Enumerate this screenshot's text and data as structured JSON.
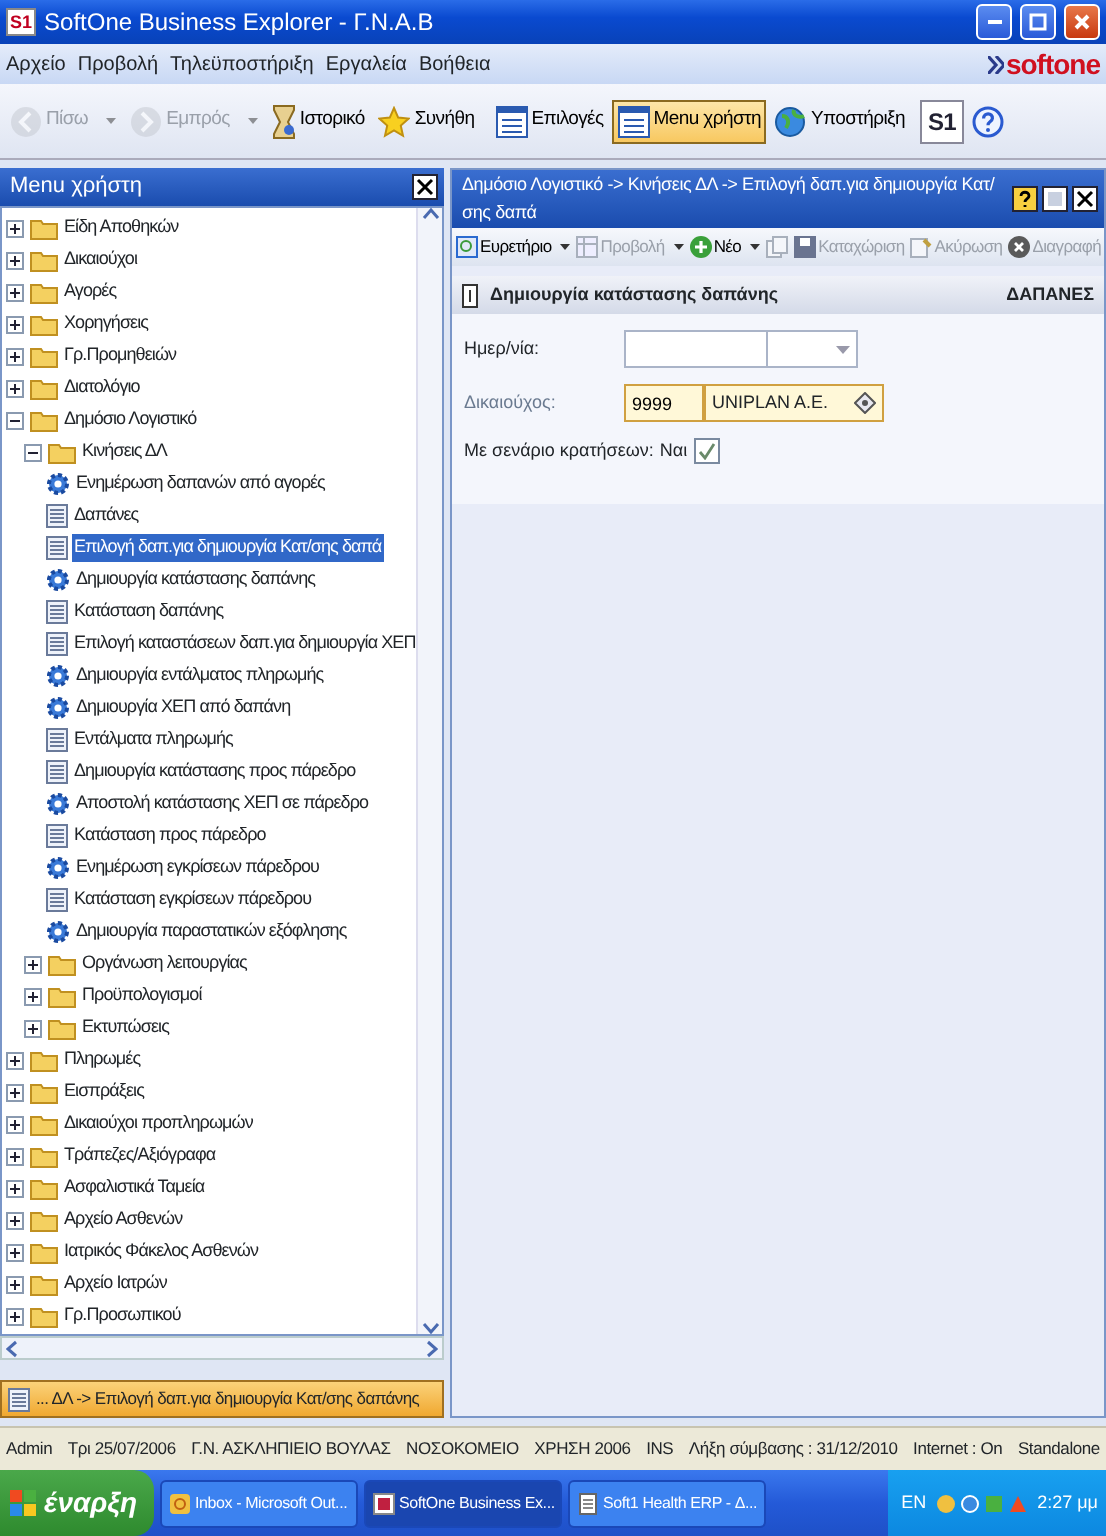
{
  "window": {
    "icon": "S1",
    "title": "SoftOne Business Explorer - Γ.Ν.Α.Β"
  },
  "menu": [
    "Αρχείο",
    "Προβολή",
    "Τηλεϋποστήριξη",
    "Εργαλεία",
    "Βοήθεια"
  ],
  "logo": "softone",
  "toolbar": [
    {
      "label": "Πίσω",
      "kind": "back",
      "disabled": true,
      "dropdown": true,
      "selected": false
    },
    {
      "label": "Εμπρός",
      "kind": "forward",
      "disabled": true,
      "dropdown": true,
      "selected": false
    },
    {
      "label": "Ιστορικό",
      "kind": "history",
      "disabled": false,
      "dropdown": false,
      "selected": false
    },
    {
      "label": "Συνήθη",
      "kind": "star",
      "disabled": false,
      "dropdown": false,
      "selected": false
    },
    {
      "label": "Επιλογές",
      "kind": "list",
      "disabled": false,
      "dropdown": false,
      "selected": false
    },
    {
      "label": "Menu χρήστη",
      "kind": "list",
      "disabled": false,
      "dropdown": false,
      "selected": true
    },
    {
      "label": "Υποστήριξη",
      "kind": "globe",
      "disabled": false,
      "dropdown": false,
      "selected": false
    },
    {
      "label": "S1",
      "kind": "brand",
      "disabled": false,
      "dropdown": false,
      "selected": false
    },
    {
      "kind": "help",
      "disabled": false,
      "dropdown": false,
      "selected": false
    }
  ],
  "left_panel": {
    "title": "Menu χρήστη",
    "tree": [
      {
        "label": "Είδη Αποθηκών",
        "kind": "folder",
        "expanded": false,
        "selected": false
      },
      {
        "label": "Δικαιούχοι",
        "kind": "folder",
        "expanded": false,
        "selected": false
      },
      {
        "label": "Αγορές",
        "kind": "folder",
        "expanded": false,
        "selected": false
      },
      {
        "label": "Χορηγήσεις",
        "kind": "folder",
        "expanded": false,
        "selected": false
      },
      {
        "label": "Γρ.Προμηθειών",
        "kind": "folder",
        "expanded": false,
        "selected": false
      },
      {
        "label": "Διατολόγιο",
        "kind": "folder",
        "expanded": false,
        "selected": false
      },
      {
        "label": "Δημόσιο Λογιστικό",
        "kind": "folder",
        "expanded": true,
        "selected": false,
        "children": [
          {
            "label": "Κινήσεις ΔΛ",
            "kind": "folder",
            "expanded": true,
            "selected": false,
            "children": [
              {
                "label": "Ενημέρωση δαπανών από αγορές",
                "kind": "process",
                "selected": false
              },
              {
                "label": "Δαπάνες",
                "kind": "report",
                "selected": false
              },
              {
                "label": "Επιλογή δαπ.για δημιουργία Κατ/σης δαπά",
                "kind": "report",
                "selected": true
              },
              {
                "label": "Δημιουργία κατάστασης δαπάνης",
                "kind": "process",
                "selected": false
              },
              {
                "label": "Κατάσταση δαπάνης",
                "kind": "report",
                "selected": false
              },
              {
                "label": "Επιλογή καταστάσεων δαπ.για δημιουργία ΧΕΠ",
                "kind": "report",
                "selected": false
              },
              {
                "label": "Δημιουργία εντάλματος πληρωμής",
                "kind": "process",
                "selected": false
              },
              {
                "label": "Δημιουργία ΧΕΠ από δαπάνη",
                "kind": "process",
                "selected": false
              },
              {
                "label": "Εντάλματα πληρωμής",
                "kind": "report",
                "selected": false
              },
              {
                "label": "Δημιουργία κατάστασης προς πάρεδρο",
                "kind": "report",
                "selected": false
              },
              {
                "label": "Αποστολή κατάστασης ΧΕΠ σε πάρεδρο",
                "kind": "process",
                "selected": false
              },
              {
                "label": "Κατάσταση προς πάρεδρο",
                "kind": "report",
                "selected": false
              },
              {
                "label": "Ενημέρωση εγκρίσεων πάρεδρου",
                "kind": "process",
                "selected": false
              },
              {
                "label": "Κατάσταση εγκρίσεων πάρεδρου",
                "kind": "report",
                "selected": false
              },
              {
                "label": "Δημιουργία παραστατικών εξόφλησης",
                "kind": "process",
                "selected": false
              }
            ]
          },
          {
            "label": "Οργάνωση λειτουργίας",
            "kind": "folder",
            "expanded": false,
            "selected": false
          },
          {
            "label": "Προϋπολογισμοί",
            "kind": "folder",
            "expanded": false,
            "selected": false
          },
          {
            "label": "Εκτυπώσεις",
            "kind": "folder",
            "expanded": false,
            "selected": false
          }
        ]
      },
      {
        "label": "Πληρωμές",
        "kind": "folder",
        "expanded": false,
        "selected": false
      },
      {
        "label": "Εισπράξεις",
        "kind": "folder",
        "expanded": false,
        "selected": false
      },
      {
        "label": "Δικαιούχοι προπληρωμών",
        "kind": "folder",
        "expanded": false,
        "selected": false
      },
      {
        "label": "Τράπεζες/Αξιόγραφα",
        "kind": "folder",
        "expanded": false,
        "selected": false
      },
      {
        "label": "Ασφαλιστικά Ταμεία",
        "kind": "folder",
        "expanded": false,
        "selected": false
      },
      {
        "label": "Αρχείο Ασθενών",
        "kind": "folder",
        "expanded": false,
        "selected": false
      },
      {
        "label": "Ιατρικός Φάκελος Ασθενών",
        "kind": "folder",
        "expanded": false,
        "selected": false
      },
      {
        "label": "Αρχείο Ιατρών",
        "kind": "folder",
        "expanded": false,
        "selected": false
      },
      {
        "label": "Γρ.Προσωπικού",
        "kind": "folder",
        "expanded": false,
        "selected": false
      }
    ],
    "footer": "... ΔΛ -> Επιλογή δαπ.για δημιουργία Κατ/σης δαπάνης"
  },
  "right_panel": {
    "title": "Δημόσιο Λογιστικό -> Κινήσεις ΔΛ -> Επιλογή δαπ.για δημιουργία Κατ/σης δαπά",
    "toolbar": [
      {
        "label": "Ευρετήριο",
        "kind": "index",
        "disabled": false,
        "dropdown": true
      },
      {
        "label": "Προβολή",
        "kind": "view",
        "disabled": true,
        "dropdown": true
      },
      {
        "label": "Νέο",
        "kind": "new",
        "disabled": false,
        "dropdown": true
      },
      {
        "kind": "copy",
        "disabled": true,
        "dropdown": false
      },
      {
        "label": "Καταχώριση",
        "kind": "save",
        "disabled": true,
        "dropdown": false
      },
      {
        "label": "Ακύρωση",
        "kind": "cancel",
        "disabled": true,
        "dropdown": false
      },
      {
        "label": "Διαγραφή",
        "kind": "delete",
        "disabled": true,
        "dropdown": false
      }
    ],
    "section": {
      "title": "Δημιουργία κατάστασης δαπάνης",
      "tag": "ΔΑΠΑΝΕΣ"
    },
    "fields": [
      {
        "kind": "date",
        "label": "Ημερ/νία:",
        "required": false
      },
      {
        "kind": "lookup",
        "label": "Δικαιούχος:",
        "code": "9999",
        "value": "UNIPLAN A.E.",
        "required": true
      },
      {
        "kind": "check",
        "label": "Με σενάριο κρατήσεων:",
        "value": "Ναι",
        "checked": true,
        "required": false
      }
    ]
  },
  "status_bar": [
    "Admin",
    "Τρι 25/07/2006",
    "Γ.Ν. ΑΣΚΛΗΠΙΕΙΟ ΒΟΥΛΑΣ",
    "ΝΟΣΟΚΟΜΕΙΟ",
    "ΧΡΗΣΗ 2006",
    "INS",
    "Λήξη σύμβασης : 31/12/2010",
    "Internet : On",
    "Standalone"
  ],
  "taskbar": {
    "start": "έναρξη",
    "tasks": [
      {
        "label": "Inbox - Microsoft Out...",
        "kind": "mail",
        "selected": false
      },
      {
        "label": "SoftOne Business Ex...",
        "kind": "app",
        "selected": true
      },
      {
        "label": "Soft1 Health ERP - Δ...",
        "kind": "doc",
        "selected": false
      }
    ],
    "language": "EN",
    "clock": "2:27 μμ"
  }
}
